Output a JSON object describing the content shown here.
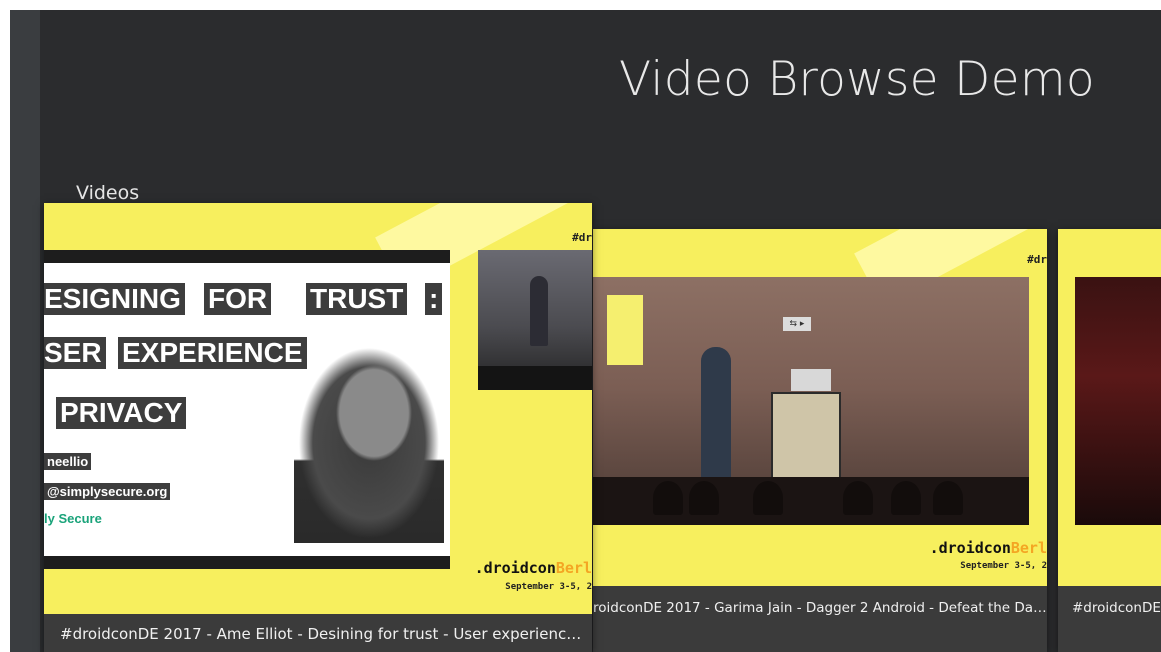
{
  "app": {
    "title": "Video Browse Demo"
  },
  "row": {
    "header": "Videos"
  },
  "cards": [
    {
      "caption": "#droidconDE 2017 - Ame Elliot - Desining for trust - User experienc…",
      "thumb": {
        "hashtag": "#dr",
        "brand_prefix": ".droidcon",
        "brand_accent": "Berl",
        "dates": "September 3-5, 2",
        "slide_lines": [
          "ESIGNING",
          "FOR",
          "TRUST",
          ":",
          "SER",
          "EXPERIENCE",
          "PRIVACY"
        ],
        "slide_handle": "neellio",
        "slide_email": "@simplysecure.org",
        "slide_brand": "ly Secure"
      },
      "focused": true
    },
    {
      "caption": "roidconDE 2017 - Garima Jain - Dagger 2 Android - Defeat the Da…",
      "thumb": {
        "hashtag": "#dr",
        "brand_prefix": ".droidcon",
        "brand_accent": "Berl",
        "dates": "September 3-5, 2",
        "sign": "⇆ ▸"
      },
      "focused": false
    },
    {
      "caption": "#droidconDE",
      "focused": false
    }
  ],
  "colors": {
    "background": "#2b2c2e",
    "rail": "#3a3d40",
    "card_caption_bg": "#3b3b3b",
    "thumb_yellow": "#f7ef5e",
    "brand_accent": "#f4a623"
  }
}
